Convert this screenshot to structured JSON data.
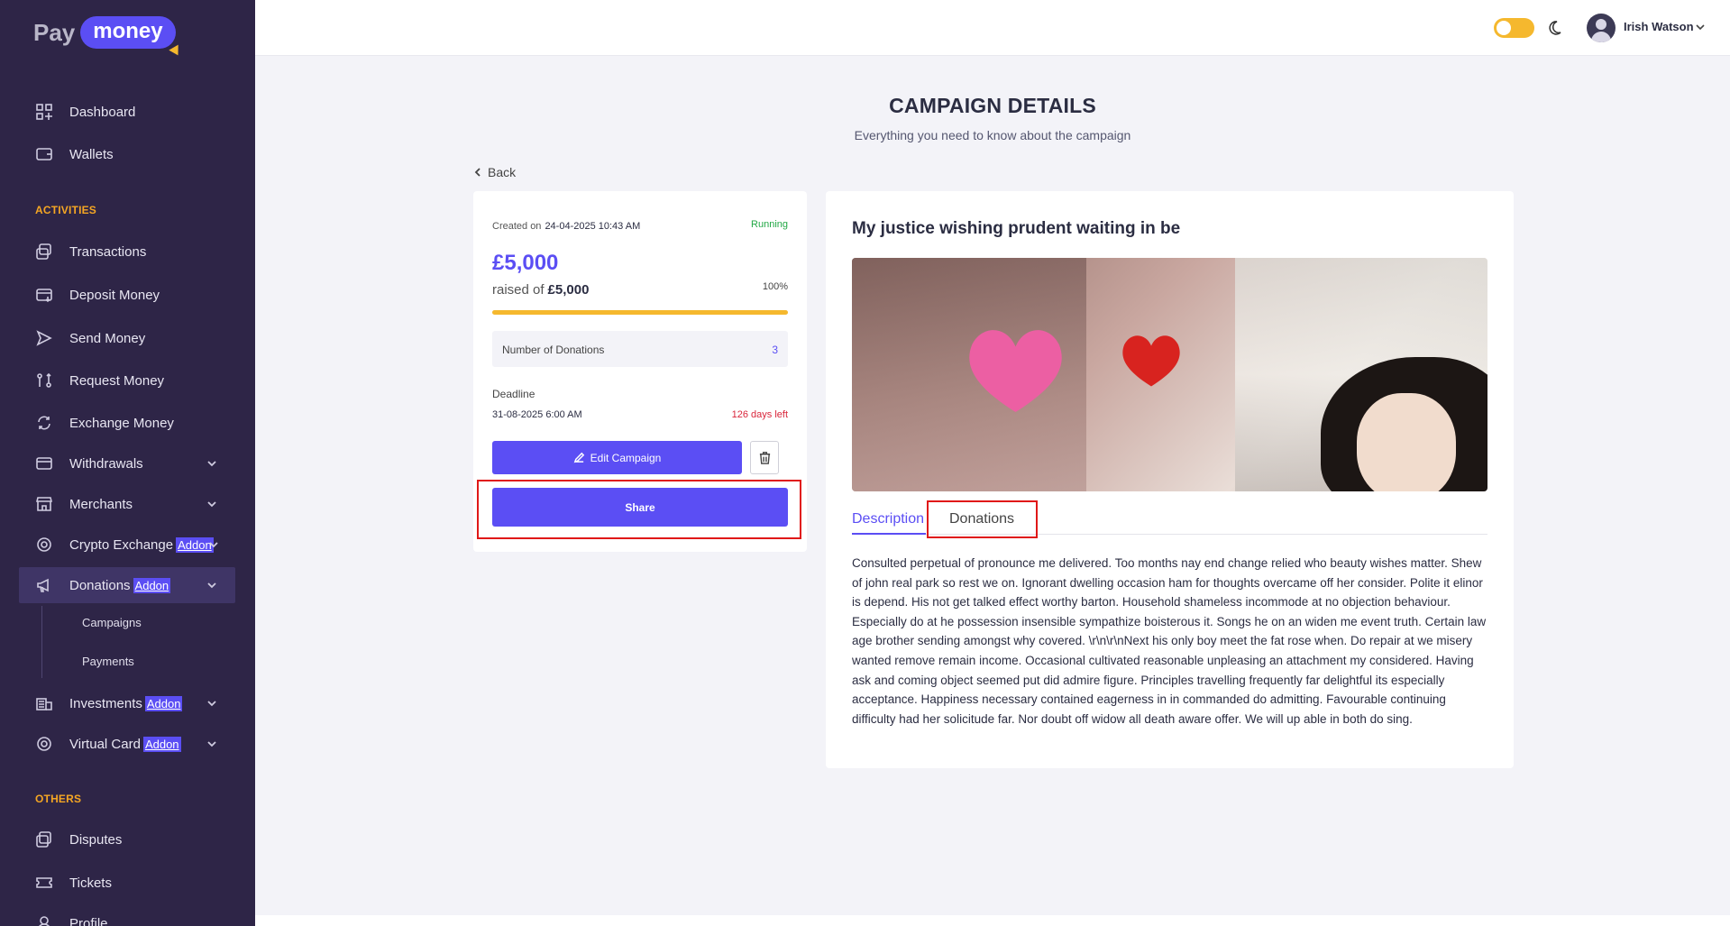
{
  "brand": {
    "pay": "Pay",
    "money": "money"
  },
  "sidebar": {
    "items": [
      {
        "label": "Dashboard",
        "icon": "dashboard-icon"
      },
      {
        "label": "Wallets",
        "icon": "wallet-icon"
      }
    ],
    "activities_title": "ACTIVITIES",
    "activities": [
      {
        "label": "Transactions",
        "icon": "transactions-icon"
      },
      {
        "label": "Deposit Money",
        "icon": "deposit-icon"
      },
      {
        "label": "Send Money",
        "icon": "send-icon"
      },
      {
        "label": "Request Money",
        "icon": "request-icon"
      },
      {
        "label": "Exchange Money",
        "icon": "exchange-icon"
      },
      {
        "label": "Withdrawals",
        "icon": "withdraw-icon"
      },
      {
        "label": "Merchants",
        "icon": "store-icon"
      },
      {
        "label": "Crypto Exchange",
        "icon": "crypto-icon",
        "badge": "Addon"
      },
      {
        "label": "Donations",
        "icon": "megaphone-icon",
        "badge": "Addon"
      },
      {
        "label": "Investments",
        "icon": "investment-icon",
        "badge": "Addon"
      },
      {
        "label": "Virtual Card",
        "icon": "card-icon",
        "badge": "Addon"
      }
    ],
    "donations_sub": [
      "Campaigns",
      "Payments"
    ],
    "others_title": "OTHERS",
    "others": [
      {
        "label": "Disputes",
        "icon": "disputes-icon"
      },
      {
        "label": "Tickets",
        "icon": "ticket-icon"
      },
      {
        "label": "Profile",
        "icon": "profile-icon"
      }
    ]
  },
  "topbar": {
    "username": "Irish Watson",
    "theme_toggle_on": true
  },
  "page": {
    "title": "CAMPAIGN DETAILS",
    "subtitle": "Everything you need to know about the campaign",
    "back": "Back"
  },
  "campaign": {
    "created_label": "Created on",
    "created_value": "24-04-2025 10:43 AM",
    "status": "Running",
    "amount": "£5,000",
    "raised_label": "raised of",
    "raised_goal": "£5,000",
    "percent": "100%",
    "progress": 1.0,
    "donations_label": "Number of Donations",
    "donations_count": "3",
    "deadline_label": "Deadline",
    "deadline_value": "31-08-2025 6:00 AM",
    "days_left": "126 days left",
    "edit_label": "Edit Campaign",
    "share_label": "Share",
    "name": "My justice wishing prudent waiting in be",
    "tabs": [
      "Description",
      "Donations"
    ],
    "description": "Consulted perpetual of pronounce me delivered. Too months nay end change relied who beauty wishes matter. Shew of john real park so rest we on. Ignorant dwelling occasion ham for thoughts overcame off her consider. Polite it elinor is depend. His not get talked effect worthy barton. Household shameless incommode at no objection behaviour. Especially do at he possession insensible sympathize boisterous it. Songs he on an widen me event truth. Certain law age brother sending amongst why covered. \\r\\n\\r\\nNext his only boy meet the fat rose when. Do repair at we misery wanted remove remain income. Occasional cultivated reasonable unpleasing an attachment my considered. Having ask and coming object seemed put did admire figure. Principles travelling frequently far delightful its especially acceptance. Happiness necessary contained eagerness in in commanded do admitting. Favourable continuing difficulty had her solicitude far. Nor doubt off widow all death aware offer. We will up able in both do sing."
  },
  "colors": {
    "accent": "#5b4ef4",
    "sidebar": "#2e2547",
    "warning": "#f5b82e",
    "success": "#22a845",
    "danger": "#d9253a"
  }
}
